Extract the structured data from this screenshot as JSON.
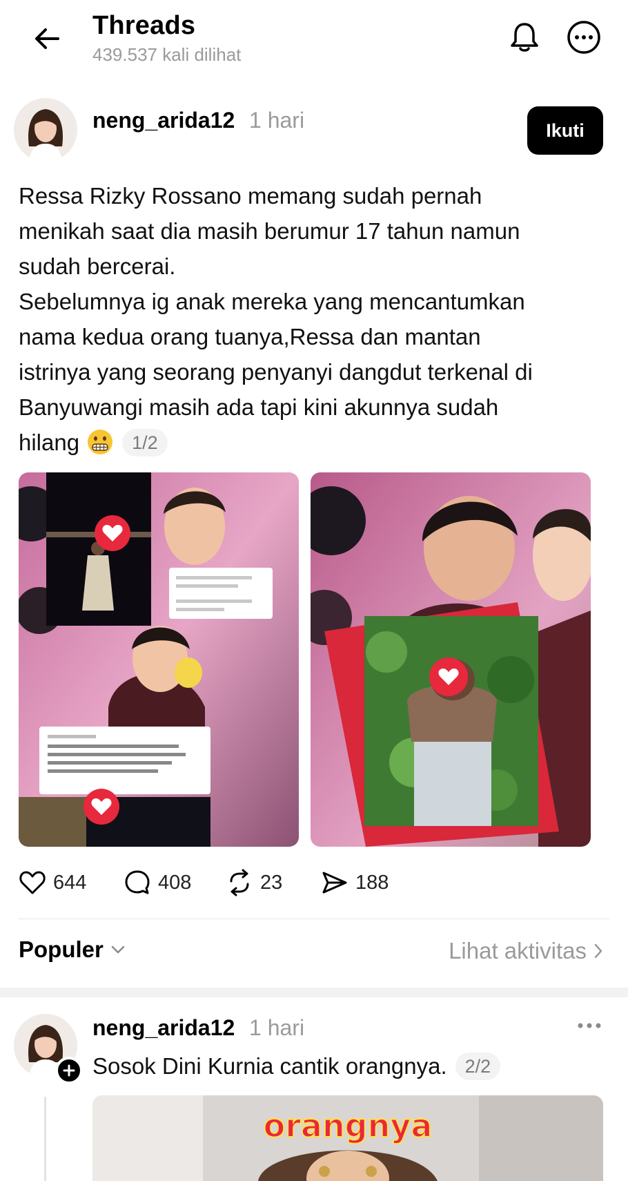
{
  "header": {
    "title": "Threads",
    "views": "439.537 kali dilihat",
    "back_icon": "arrow-left-icon",
    "bell_icon": "bell-icon",
    "more_icon": "more-circle-icon"
  },
  "post": {
    "username": "neng_arida12",
    "time": "1 hari",
    "follow_label": "Ikuti",
    "text_lines": [
      "Ressa Rizky Rossano memang sudah pernah",
      "menikah saat dia masih berumur 17 tahun namun",
      "sudah bercerai.",
      "Sebelumnya ig anak mereka yang mencantumkan",
      "nama kedua orang tuanya,Ressa dan mantan",
      "istrinya yang seorang penyanyi dangdut terkenal di",
      "Banyuwangi masih ada tapi kini akunnya sudah",
      "hilang"
    ],
    "emoji": "grimacing-face",
    "page_indicator": "1/2",
    "stats": {
      "likes": "644",
      "replies": "408",
      "reposts": "23",
      "shares": "188"
    }
  },
  "filter": {
    "sort_label": "Populer",
    "activity_label": "Lihat aktivitas"
  },
  "reply": {
    "username": "neng_arida12",
    "time": "1 hari",
    "text": "Sosok Dini Kurnia cantik orangnya.",
    "page_indicator": "2/2",
    "image_caption": "orangnya"
  },
  "colors": {
    "text_primary": "#000000",
    "text_secondary": "#9a9a9a",
    "follow_button": "#000000",
    "heart_sticker": "#e8283c"
  }
}
